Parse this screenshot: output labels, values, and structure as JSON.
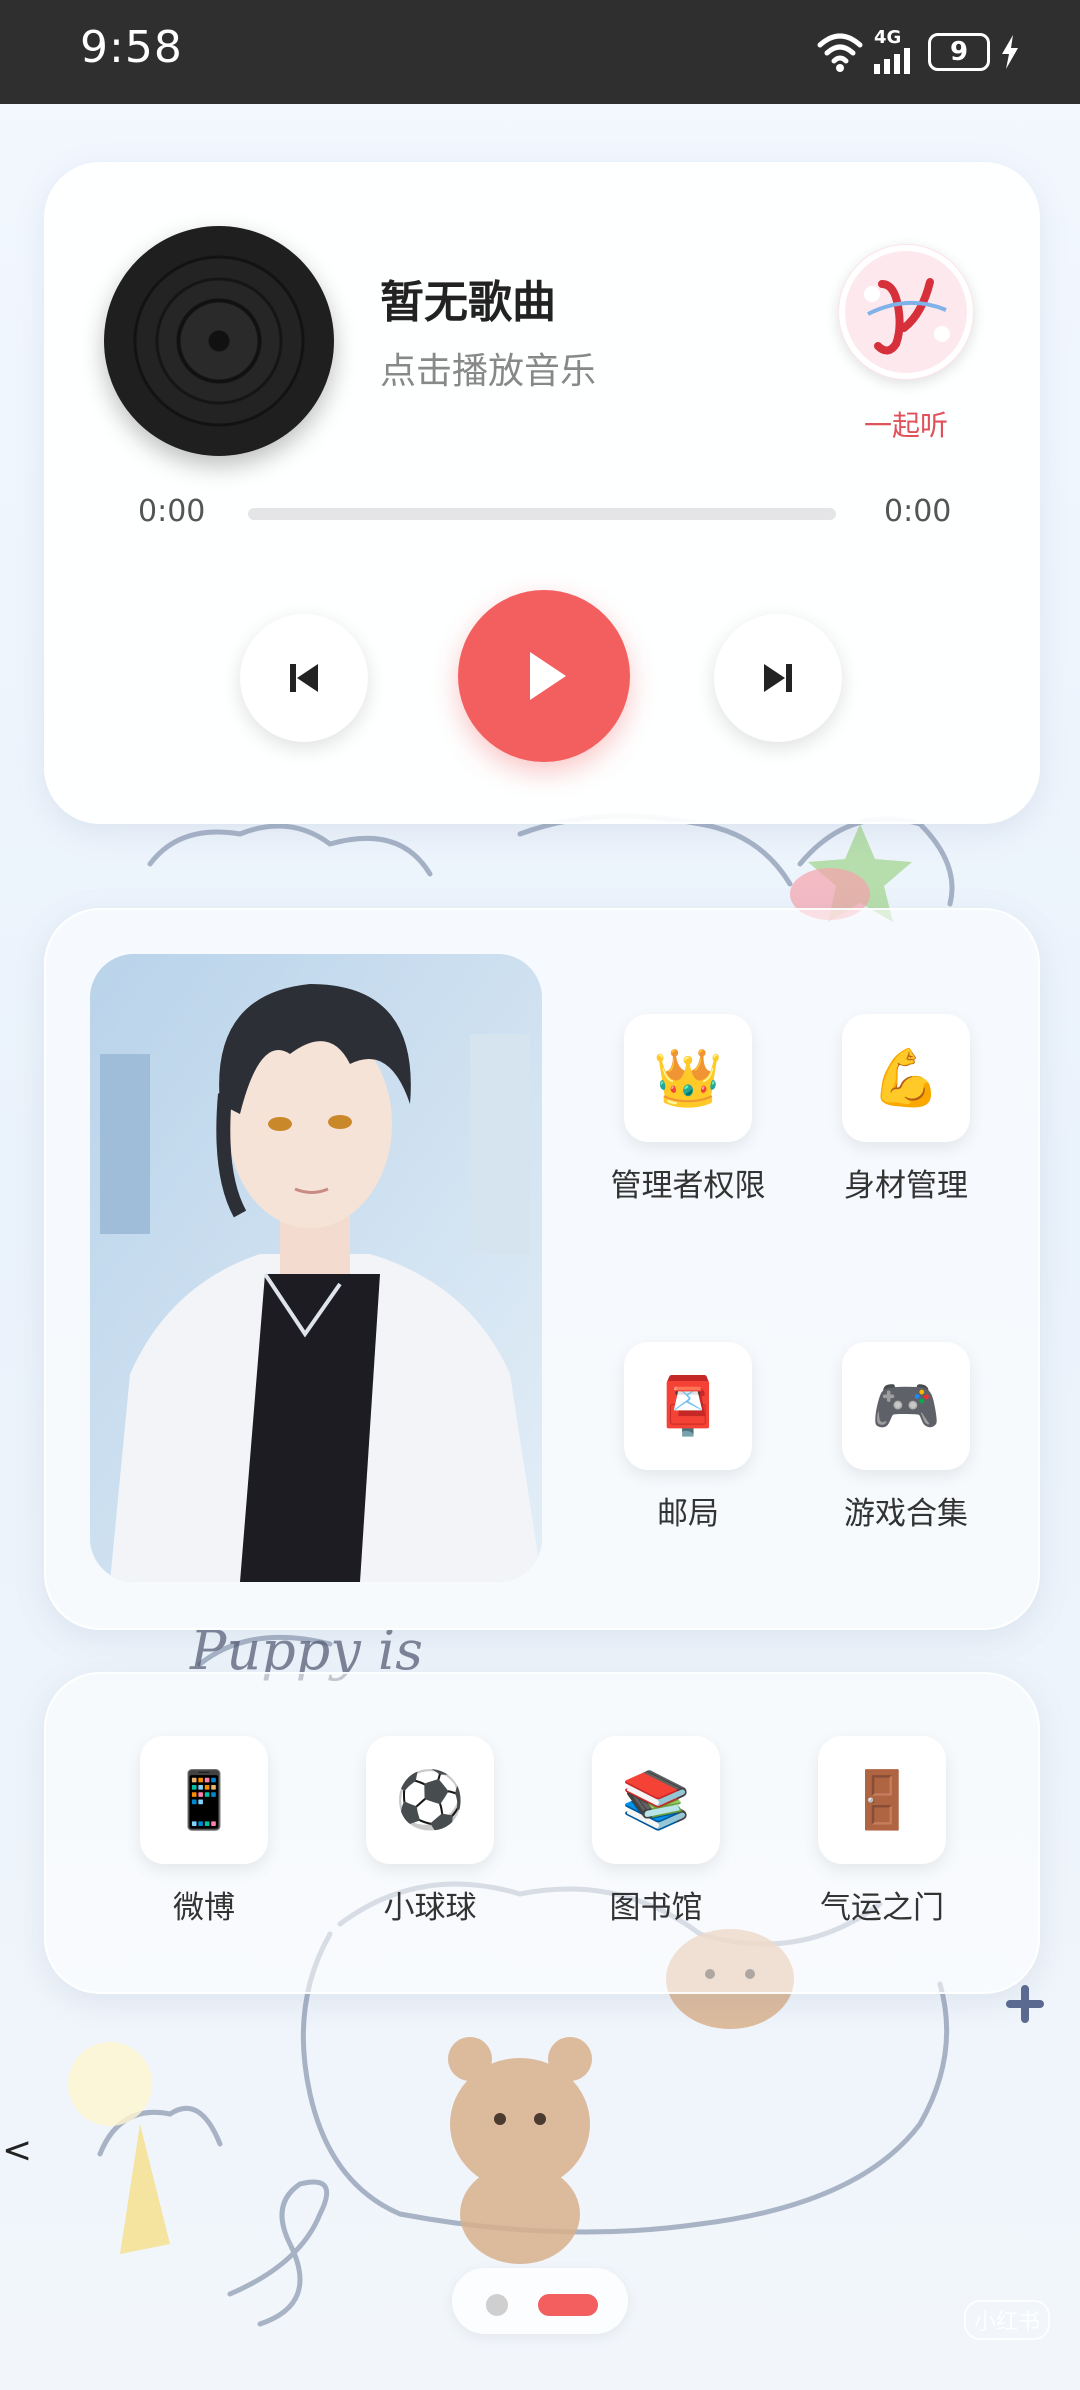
{
  "status_bar": {
    "time": "9:58",
    "network": "4G",
    "battery": "9"
  },
  "player": {
    "title": "暂无歌曲",
    "subtitle": "点击播放音乐",
    "listen_label": "一起听",
    "time_start": "0:00",
    "time_end": "0:00",
    "progress": 0,
    "accent_color": "#f35f5f"
  },
  "grid": {
    "items": [
      {
        "label": "管理者权限",
        "icon": "crown-icon",
        "glyph": "👑"
      },
      {
        "label": "身材管理",
        "icon": "flexed-biceps-icon",
        "glyph": "💪"
      },
      {
        "label": "邮局",
        "icon": "postbox-icon",
        "glyph": "📮"
      },
      {
        "label": "游戏合集",
        "icon": "gamepad-icon",
        "glyph": "🎮"
      }
    ]
  },
  "apps": {
    "items": [
      {
        "label": "微博",
        "icon": "phone-icon",
        "glyph": "📱"
      },
      {
        "label": "小球球",
        "icon": "soccer-ball-icon",
        "glyph": "⚽"
      },
      {
        "label": "图书馆",
        "icon": "books-icon",
        "glyph": "📚"
      },
      {
        "label": "气运之门",
        "icon": "door-icon",
        "glyph": "🚪"
      }
    ]
  },
  "nav": {
    "back": "<"
  },
  "watermark": {
    "badge": "小红书"
  }
}
